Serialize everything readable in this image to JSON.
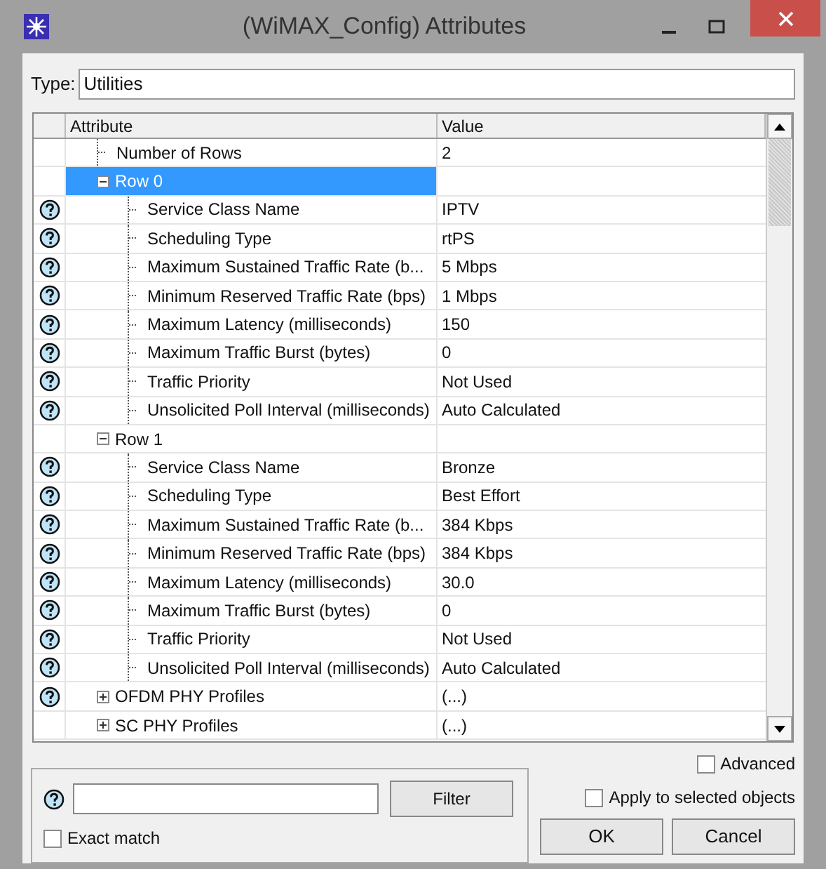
{
  "window": {
    "title": "(WiMAX_Config) Attributes"
  },
  "type_field": {
    "label": "Type:",
    "value": "Utilities"
  },
  "table": {
    "columns": [
      "Attribute",
      "Value"
    ],
    "rows": [
      {
        "label": "Number of Rows",
        "value": "2",
        "help": false,
        "selected": false
      },
      {
        "label": "Row 0",
        "value": "",
        "help": false,
        "selected": true,
        "expanded": true,
        "children": [
          {
            "label": "Service Class Name",
            "value": "IPTV",
            "help": true,
            "selected": false
          },
          {
            "label": "Scheduling Type",
            "value": "rtPS",
            "help": true,
            "selected": false
          },
          {
            "label": "Maximum Sustained Traffic Rate (b...",
            "value": "5 Mbps",
            "help": true,
            "selected": false
          },
          {
            "label": "Minimum Reserved Traffic Rate (bps)",
            "value": "1 Mbps",
            "help": true,
            "selected": false
          },
          {
            "label": "Maximum Latency (milliseconds)",
            "value": "150",
            "help": true,
            "selected": false
          },
          {
            "label": "Maximum Traffic Burst (bytes)",
            "value": "0",
            "help": true,
            "selected": false
          },
          {
            "label": "Traffic Priority",
            "value": "Not Used",
            "help": true,
            "selected": false
          },
          {
            "label": "Unsolicited Poll Interval (milliseconds)",
            "value": "Auto Calculated",
            "help": true,
            "selected": false
          }
        ]
      },
      {
        "label": "Row 1",
        "value": "",
        "help": false,
        "selected": false,
        "expanded": true,
        "children": [
          {
            "label": "Service Class Name",
            "value": "Bronze",
            "help": true,
            "selected": false
          },
          {
            "label": "Scheduling Type",
            "value": "Best Effort",
            "help": true,
            "selected": false
          },
          {
            "label": "Maximum Sustained Traffic Rate (b...",
            "value": "384 Kbps",
            "help": true,
            "selected": false
          },
          {
            "label": "Minimum Reserved Traffic Rate (bps)",
            "value": "384 Kbps",
            "help": true,
            "selected": false
          },
          {
            "label": "Maximum Latency (milliseconds)",
            "value": "30.0",
            "help": true,
            "selected": false
          },
          {
            "label": "Maximum Traffic Burst (bytes)",
            "value": "0",
            "help": true,
            "selected": false
          },
          {
            "label": "Traffic Priority",
            "value": "Not Used",
            "help": true,
            "selected": false
          },
          {
            "label": "Unsolicited Poll Interval (milliseconds)",
            "value": "Auto Calculated",
            "help": true,
            "selected": false
          }
        ]
      },
      {
        "label": "OFDM PHY Profiles",
        "value": "(...)",
        "help": true,
        "selected": false,
        "expanded": false,
        "children": []
      },
      {
        "label": "SC PHY Profiles",
        "value": "(...)",
        "help": false,
        "selected": false,
        "expanded": false,
        "children": []
      }
    ]
  },
  "filter": {
    "button": "Filter",
    "exact_match": {
      "label": "Exact match",
      "checked": false
    }
  },
  "advanced": {
    "label": "Advanced",
    "checked": false
  },
  "apply_selected": {
    "label": "Apply to selected objects",
    "checked": false
  },
  "buttons": [
    "OK",
    "Cancel"
  ]
}
